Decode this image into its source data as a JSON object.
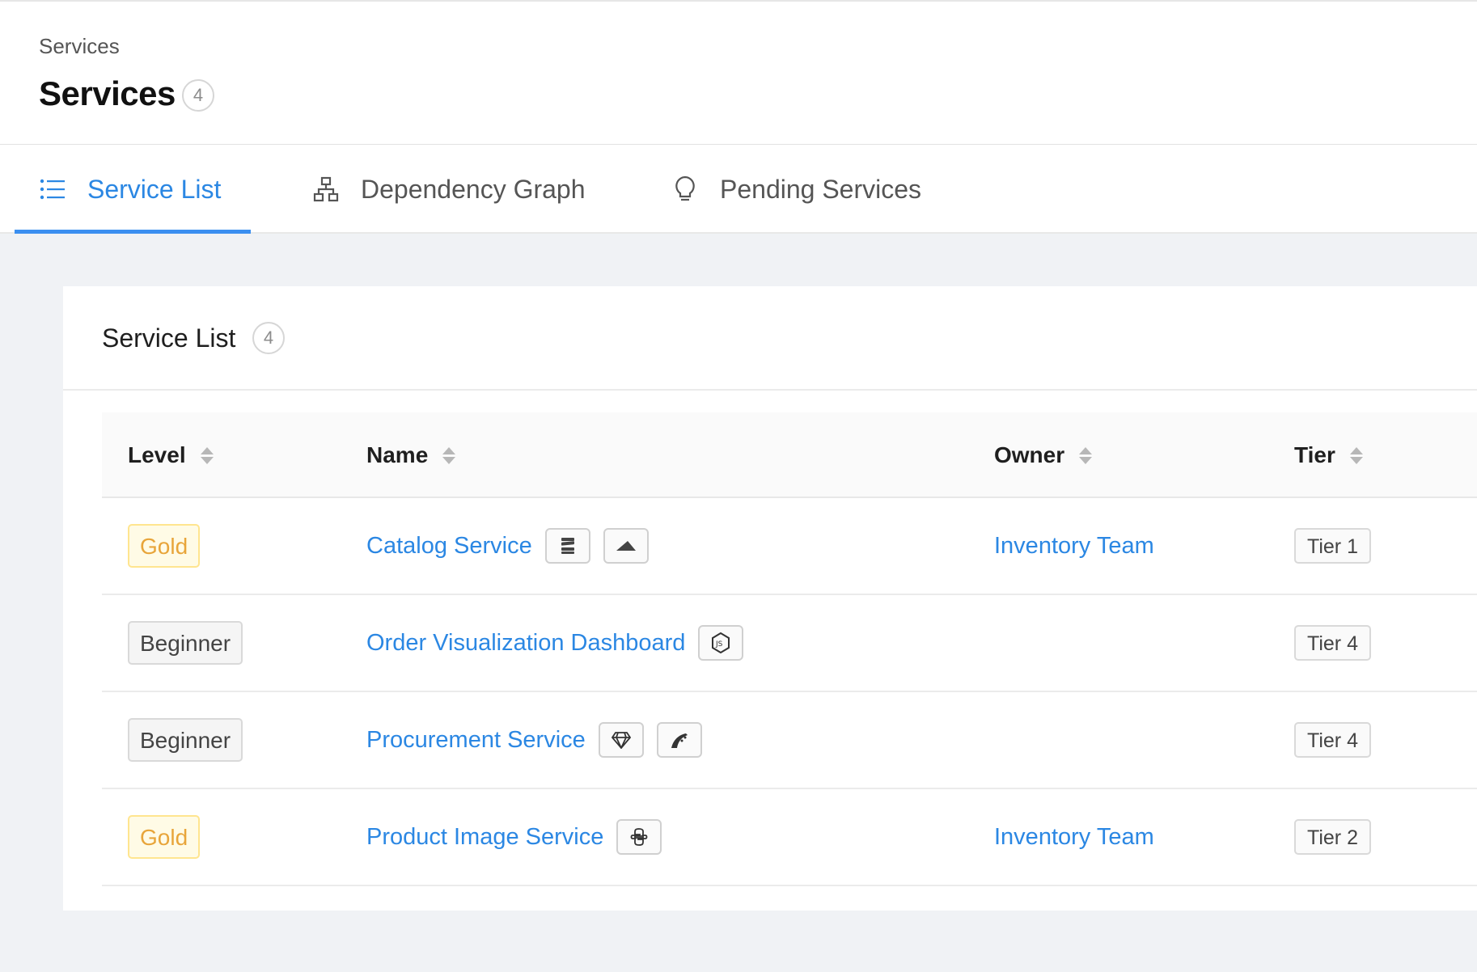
{
  "header": {
    "breadcrumb": "Services",
    "title": "Services",
    "count": "4"
  },
  "tabs": [
    {
      "label": "Service List",
      "icon": "list-icon",
      "active": true
    },
    {
      "label": "Dependency Graph",
      "icon": "hierarchy-icon",
      "active": false
    },
    {
      "label": "Pending Services",
      "icon": "lightbulb-icon",
      "active": false
    }
  ],
  "card": {
    "title": "Service List",
    "count": "4"
  },
  "table": {
    "columns": [
      "Level",
      "Name",
      "Owner",
      "Tier"
    ],
    "rows": [
      {
        "level": "Gold",
        "name": "Catalog Service",
        "languages": [
          "database-icon",
          "aws-lambda-icon"
        ],
        "owner": "Inventory Team",
        "tier": "Tier 1"
      },
      {
        "level": "Beginner",
        "name": "Order Visualization Dashboard",
        "languages": [
          "nodejs-icon"
        ],
        "owner": "",
        "tier": "Tier 4"
      },
      {
        "level": "Beginner",
        "name": "Procurement Service",
        "languages": [
          "ruby-icon",
          "rails-icon"
        ],
        "owner": "",
        "tier": "Tier 4"
      },
      {
        "level": "Gold",
        "name": "Product Image Service",
        "languages": [
          "python-icon"
        ],
        "owner": "Inventory Team",
        "tier": "Tier 2"
      }
    ]
  },
  "colors": {
    "accent": "#2b87e3",
    "gold_text": "#e8a53a",
    "gold_bg": "#fffbe6",
    "page_bg": "#f0f2f5"
  }
}
